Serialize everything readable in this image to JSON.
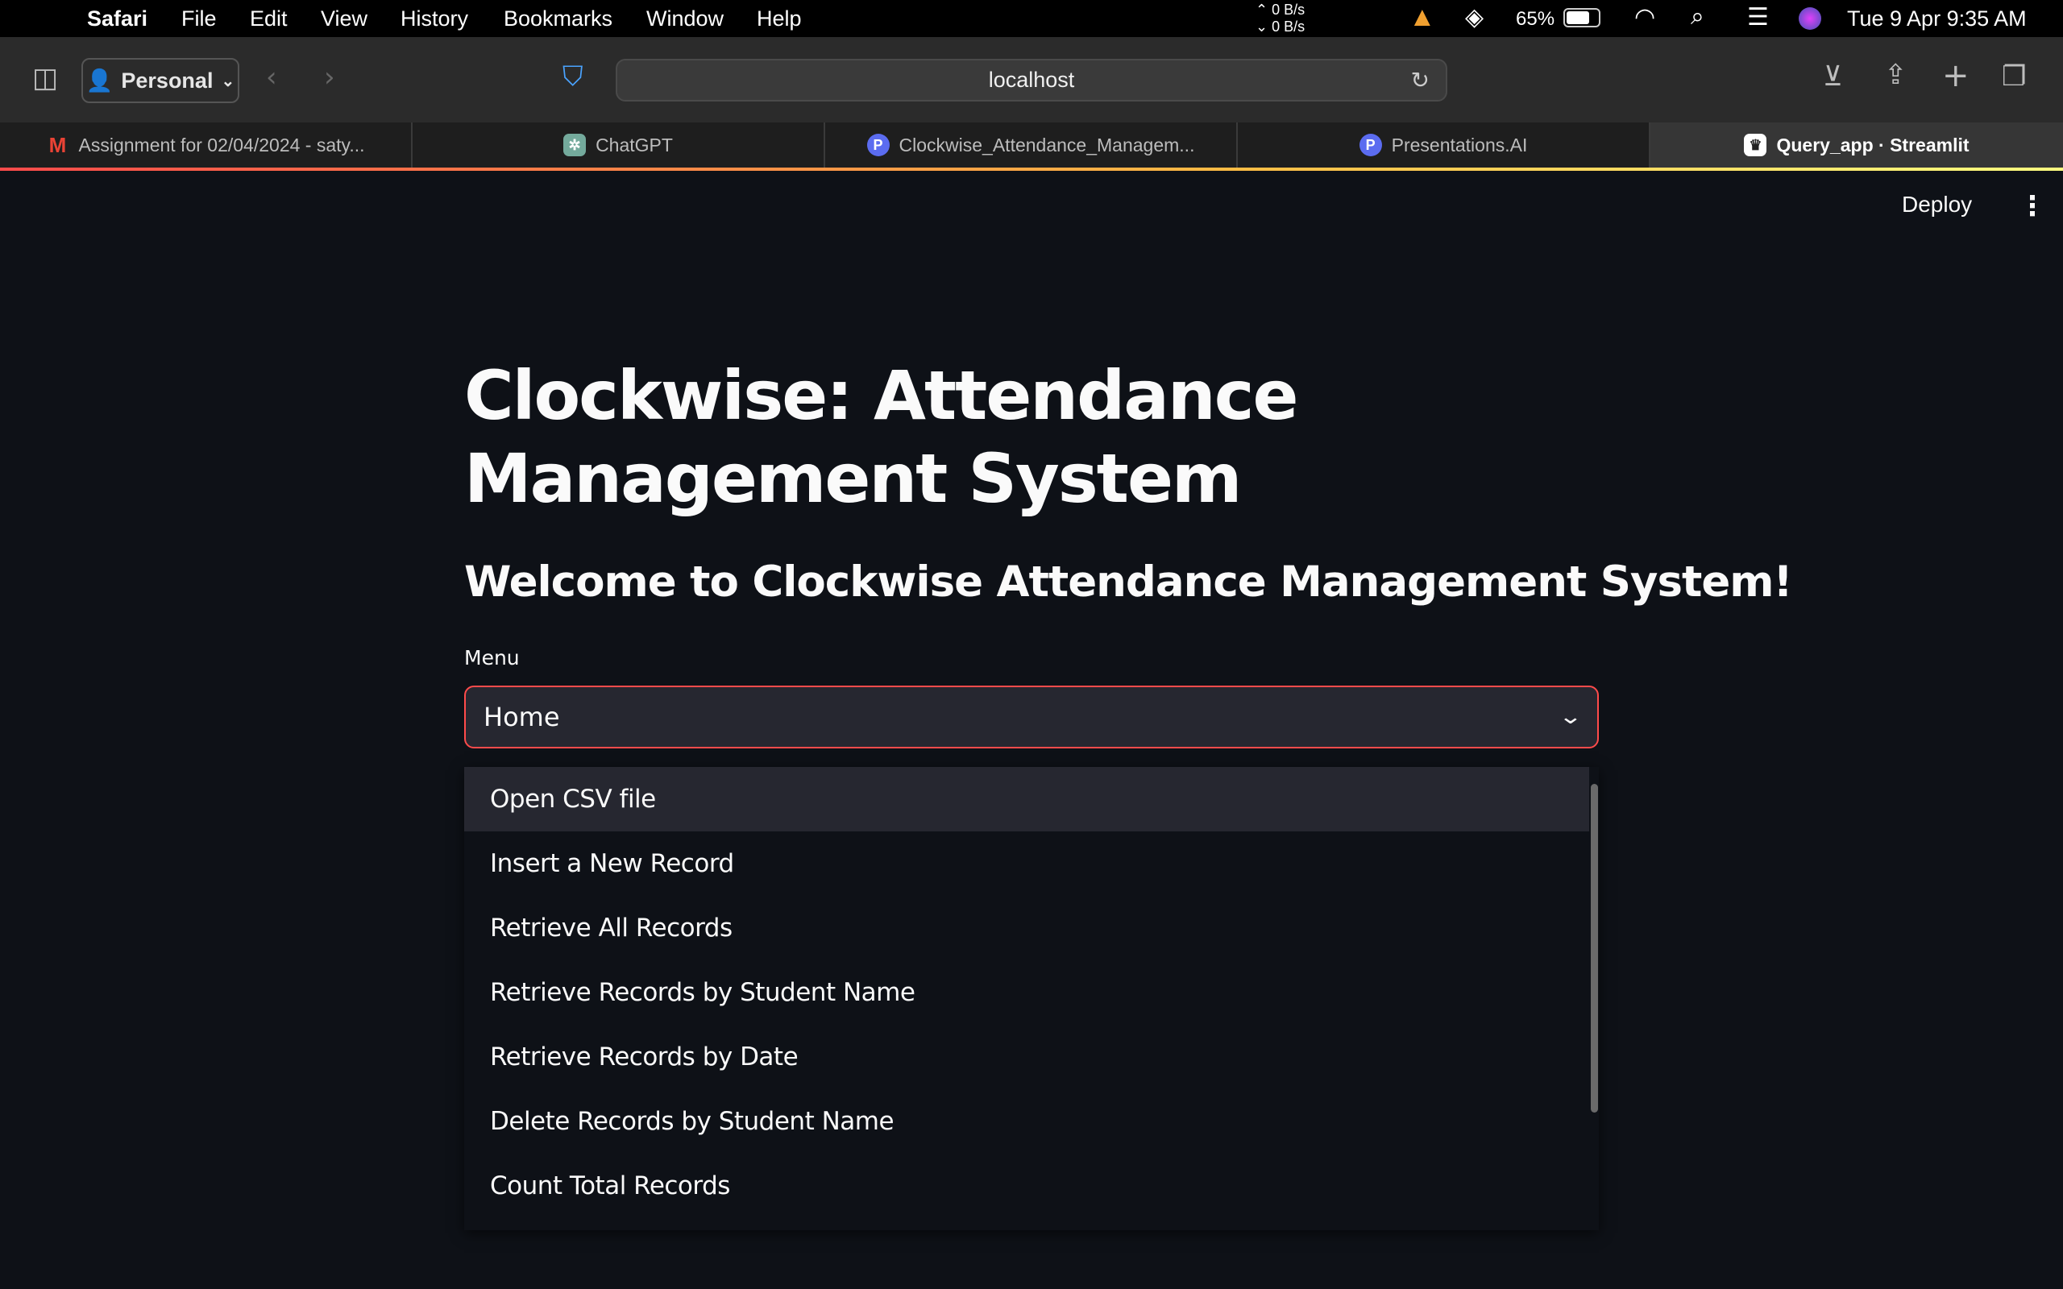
{
  "menubar": {
    "apple": "",
    "app": "Safari",
    "items": [
      "File",
      "Edit",
      "View",
      "History",
      "Bookmarks",
      "Window",
      "Help"
    ],
    "net_up": "0 B/s",
    "net_down": "0 B/s",
    "battery": "65%",
    "datetime": "Tue 9 Apr  9:35 AM"
  },
  "toolbar": {
    "profile": "Personal",
    "url": "localhost"
  },
  "tabs": [
    {
      "label": "Assignment for 02/04/2024 - saty...",
      "icon": "gmail-icon",
      "color": "#ea4335"
    },
    {
      "label": "ChatGPT",
      "icon": "chatgpt-icon",
      "color": "#74aa9c"
    },
    {
      "label": "Clockwise_Attendance_Managem...",
      "icon": "presentations-ai-icon",
      "color": "#5b6cf0"
    },
    {
      "label": "Presentations.AI",
      "icon": "presentations-ai-icon",
      "color": "#5b6cf0"
    },
    {
      "label": "Query_app · Streamlit",
      "icon": "streamlit-icon",
      "color": "#ffffff",
      "active": true
    }
  ],
  "app": {
    "deploy": "Deploy",
    "title": "Clockwise: Attendance Management System",
    "subtitle": "Welcome to Clockwise Attendance Management System!",
    "menu_label": "Menu",
    "selected": "Home",
    "options": [
      "Open CSV file",
      "Insert a New Record",
      "Retrieve All Records",
      "Retrieve Records by Student Name",
      "Retrieve Records by Date",
      "Delete Records by Student Name",
      "Count Total Records"
    ],
    "accent": "#ff4b4b"
  }
}
